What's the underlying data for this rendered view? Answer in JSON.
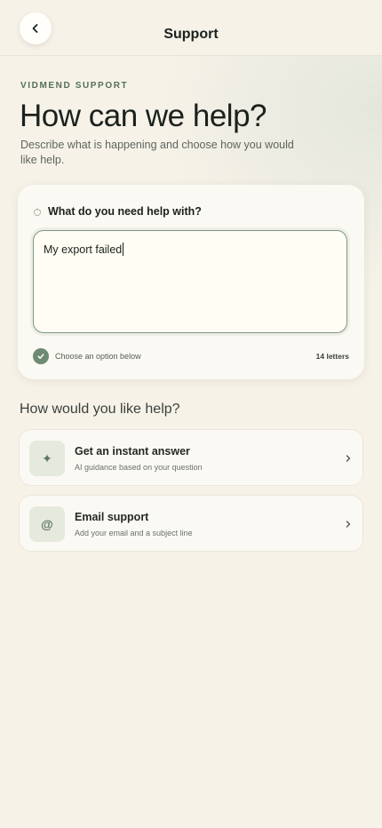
{
  "header": {
    "title": "Support",
    "back_icon": "chevron-left-icon"
  },
  "hero": {
    "eyebrow": "VIDMEND SUPPORT",
    "title": "How can we help?",
    "subtitle": "Describe what is happening and choose how you would like help."
  },
  "question_card": {
    "label": "What do you need help with?",
    "input_value": "My export failed",
    "hint": "Choose an option below",
    "count": "14 letters"
  },
  "options_section": {
    "title": "How would you like help?",
    "options": [
      {
        "title": "Get an instant answer",
        "subtitle": "AI guidance based on your question",
        "icon": "sparkle-icon",
        "glyph": "✦"
      },
      {
        "title": "Email support",
        "subtitle": "Add your email and a subject line",
        "icon": "at-sign-icon",
        "glyph": "@"
      }
    ]
  },
  "colors": {
    "background": "#f6f2e8",
    "accent": "#6d8a72",
    "card": "#fbf9f3",
    "text": "#1b211d"
  }
}
